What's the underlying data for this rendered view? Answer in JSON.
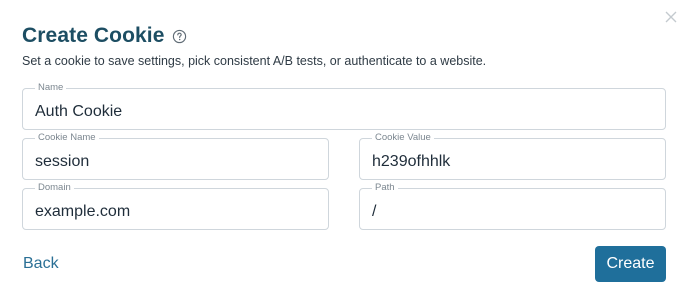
{
  "dialog": {
    "title": "Create Cookie",
    "subtitle": "Set a cookie to save settings, pick consistent A/B tests, or authenticate to a website.",
    "icons": {
      "help": "help-circle-icon",
      "close": "close-icon"
    }
  },
  "form": {
    "name": {
      "label": "Name",
      "value": "Auth Cookie"
    },
    "cookie_name": {
      "label": "Cookie Name",
      "value": "session"
    },
    "cookie_value": {
      "label": "Cookie Value",
      "value": "h239ofhhlk"
    },
    "domain": {
      "label": "Domain",
      "value": "example.com"
    },
    "path": {
      "label": "Path",
      "value": "/"
    }
  },
  "actions": {
    "back_label": "Back",
    "create_label": "Create"
  },
  "colors": {
    "title": "#1d4e63",
    "primary_button": "#1f6f9b",
    "link": "#2a6f95",
    "border": "#cfd6dc"
  }
}
